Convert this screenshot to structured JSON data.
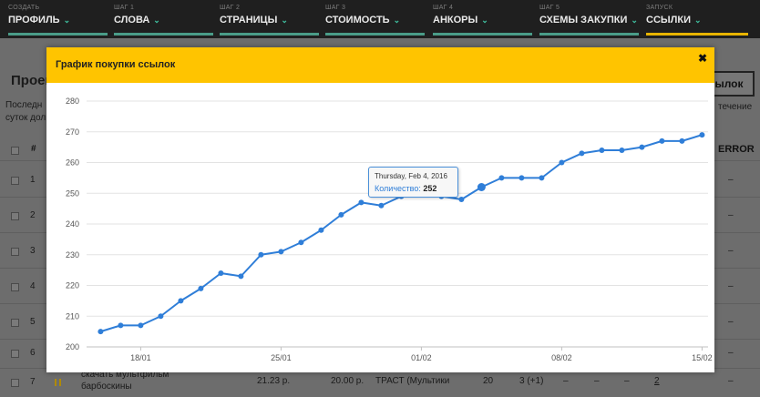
{
  "steps": [
    {
      "cap": "СОЗДАТЬ",
      "name": "ПРОФИЛЬ"
    },
    {
      "cap": "ШАГ 1",
      "name": "СЛОВА"
    },
    {
      "cap": "ШАГ 2",
      "name": "СТРАНИЦЫ"
    },
    {
      "cap": "ШАГ 3",
      "name": "СТОИМОСТЬ"
    },
    {
      "cap": "ШАГ 4",
      "name": "АНКОРЫ"
    },
    {
      "cap": "ШАГ 5",
      "name": "СХЕМЫ ЗАКУПКИ"
    },
    {
      "cap": "ЗАПУСК",
      "name": "ССЫЛКИ"
    }
  ],
  "page": {
    "title": "Проек",
    "button_label": "ылок",
    "text_line1": "Последн",
    "text_line2": "суток дол",
    "right_text": "течение",
    "col_hash": "#",
    "col_error": "ERROR",
    "rows": [
      "1",
      "2",
      "3",
      "4",
      "5",
      "6"
    ],
    "dash": "–",
    "row7": {
      "num": "7",
      "title_line1": "скачать мультфильм",
      "title_line2": "барбоскины",
      "price1": "21.23 р.",
      "price2": "20.00 р.",
      "source": "ТРАСТ (Мультики",
      "count": "20",
      "delta": "3 (+1)",
      "dash": "–",
      "last": "2"
    }
  },
  "modal": {
    "title": "График покупки ссылок",
    "close": "✖",
    "tooltip": {
      "date": "Thursday, Feb 4, 2016",
      "label": "Количество:",
      "value": "252"
    }
  },
  "colors": {
    "line": "#2f7ed8",
    "header": "#ffc400",
    "step_active": "#e8b400",
    "step_bar": "#4a9c88"
  },
  "chart_data": {
    "type": "line",
    "title": "",
    "xlabel": "",
    "ylabel": "",
    "ylim": [
      200,
      280
    ],
    "yticks": [
      200,
      210,
      220,
      230,
      240,
      250,
      260,
      270,
      280
    ],
    "xtick_labels": [
      "18/01",
      "25/01",
      "01/02",
      "08/02",
      "15/02"
    ],
    "grid": true,
    "series": [
      {
        "name": "Количество",
        "x": [
          "2016-01-16",
          "2016-01-17",
          "2016-01-18",
          "2016-01-19",
          "2016-01-20",
          "2016-01-21",
          "2016-01-22",
          "2016-01-23",
          "2016-01-24",
          "2016-01-25",
          "2016-01-26",
          "2016-01-27",
          "2016-01-28",
          "2016-01-29",
          "2016-01-30",
          "2016-01-31",
          "2016-02-01",
          "2016-02-02",
          "2016-02-03",
          "2016-02-04",
          "2016-02-05",
          "2016-02-06",
          "2016-02-07",
          "2016-02-08",
          "2016-02-09",
          "2016-02-10",
          "2016-02-11",
          "2016-02-12",
          "2016-02-13",
          "2016-02-14",
          "2016-02-15"
        ],
        "values": [
          205,
          207,
          207,
          210,
          215,
          219,
          224,
          223,
          230,
          231,
          234,
          238,
          243,
          247,
          246,
          249,
          250,
          249,
          248,
          252,
          255,
          255,
          255,
          260,
          263,
          264,
          264,
          265,
          267,
          267,
          269
        ]
      }
    ],
    "highlight_index": 19
  }
}
